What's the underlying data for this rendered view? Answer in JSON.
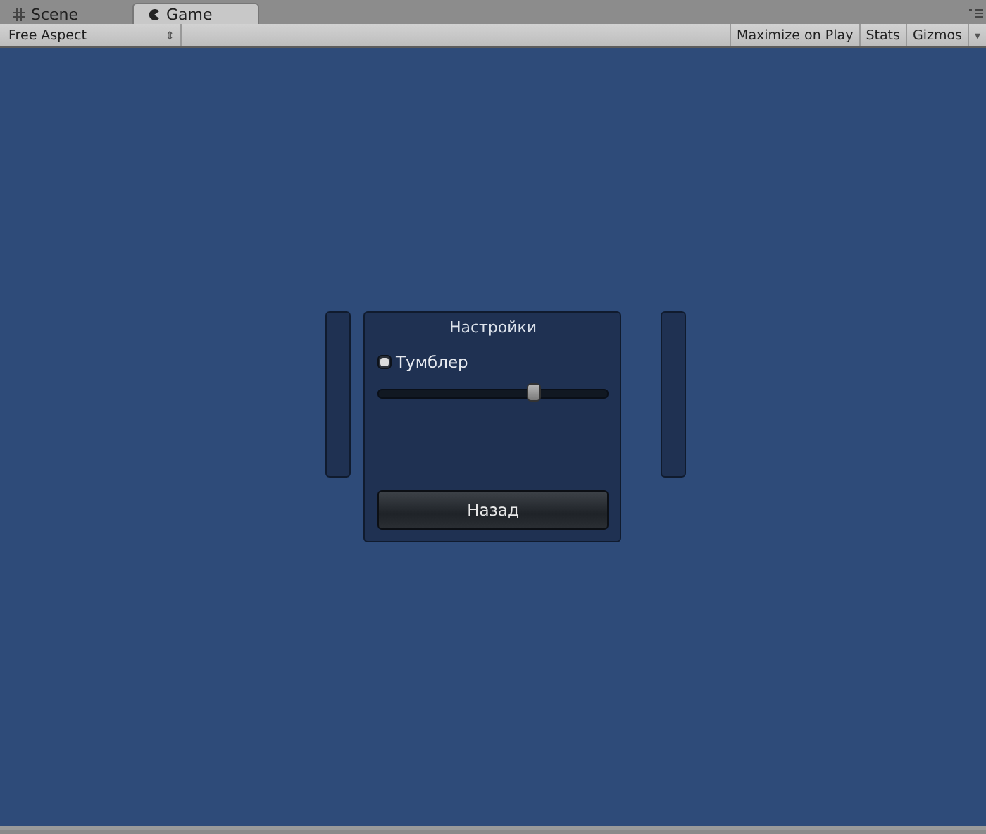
{
  "tabs": [
    {
      "label": "Scene",
      "kind": "scene",
      "selected": false
    },
    {
      "label": "Game",
      "kind": "game",
      "selected": true
    }
  ],
  "toolbar": {
    "aspect": "Free Aspect",
    "aspect_arrow": "⇕",
    "buttons": [
      "Maximize on Play",
      "Stats",
      "Gizmos"
    ],
    "gizmos_arrow": "▾"
  },
  "window": {
    "title": "Настройки",
    "toggle": {
      "label": "Тумблер",
      "checked": true
    },
    "slider": {
      "level": 0.68
    },
    "button": "Назад"
  }
}
